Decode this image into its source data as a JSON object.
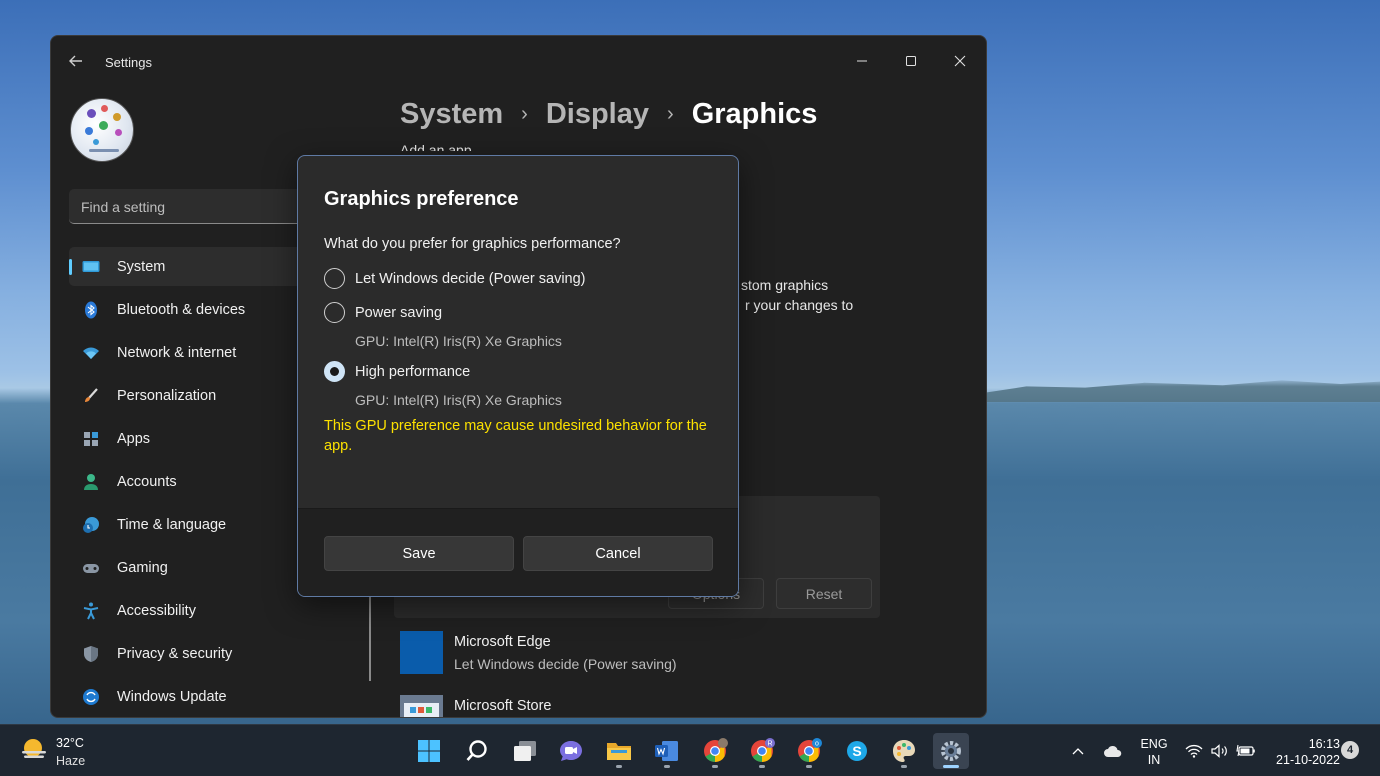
{
  "window": {
    "title": "Settings",
    "search_placeholder": "Find a setting",
    "nav": [
      {
        "label": "System",
        "icon": "monitor-icon",
        "active": true
      },
      {
        "label": "Bluetooth & devices",
        "icon": "bluetooth-icon"
      },
      {
        "label": "Network & internet",
        "icon": "wifi-icon"
      },
      {
        "label": "Personalization",
        "icon": "brush-icon"
      },
      {
        "label": "Apps",
        "icon": "apps-icon"
      },
      {
        "label": "Accounts",
        "icon": "person-icon"
      },
      {
        "label": "Time & language",
        "icon": "clock-globe-icon"
      },
      {
        "label": "Gaming",
        "icon": "controller-icon"
      },
      {
        "label": "Accessibility",
        "icon": "accessibility-icon"
      },
      {
        "label": "Privacy & security",
        "icon": "shield-icon"
      },
      {
        "label": "Windows Update",
        "icon": "update-icon"
      }
    ],
    "breadcrumb": [
      "System",
      "Display",
      "Graphics"
    ],
    "behind": {
      "add_app": "Add an app",
      "line1": "stom graphics",
      "line2": "r your changes to",
      "options_label": "Options",
      "reset_label": "Reset"
    },
    "apps": [
      {
        "name": "Microsoft Edge",
        "setting": "Let Windows decide (Power saving)"
      },
      {
        "name": "Microsoft Store",
        "setting": ""
      }
    ]
  },
  "dialog": {
    "title": "Graphics preference",
    "question": "What do you prefer for graphics performance?",
    "options": [
      {
        "label": "Let Windows decide (Power saving)",
        "gpu": "",
        "checked": false
      },
      {
        "label": "Power saving",
        "gpu": "GPU: Intel(R) Iris(R) Xe Graphics",
        "checked": false
      },
      {
        "label": "High performance",
        "gpu": "GPU: Intel(R) Iris(R) Xe Graphics",
        "checked": true
      }
    ],
    "warning": "This GPU preference may cause undesired behavior for the app.",
    "save_label": "Save",
    "cancel_label": "Cancel",
    "warning_color": "#fce100"
  },
  "taskbar": {
    "weather_temp": "32°C",
    "weather_desc": "Haze",
    "lang_line1": "ENG",
    "lang_line2": "IN",
    "time": "16:13",
    "date": "21-10-2022",
    "notifications": "4",
    "badge_r": "R",
    "badge_o": "o"
  },
  "colors": {
    "accent": "#60cdff",
    "window_bg": "#202020",
    "dialog_bg": "#2b2b2b",
    "taskbar_bg": "#1e2630"
  }
}
